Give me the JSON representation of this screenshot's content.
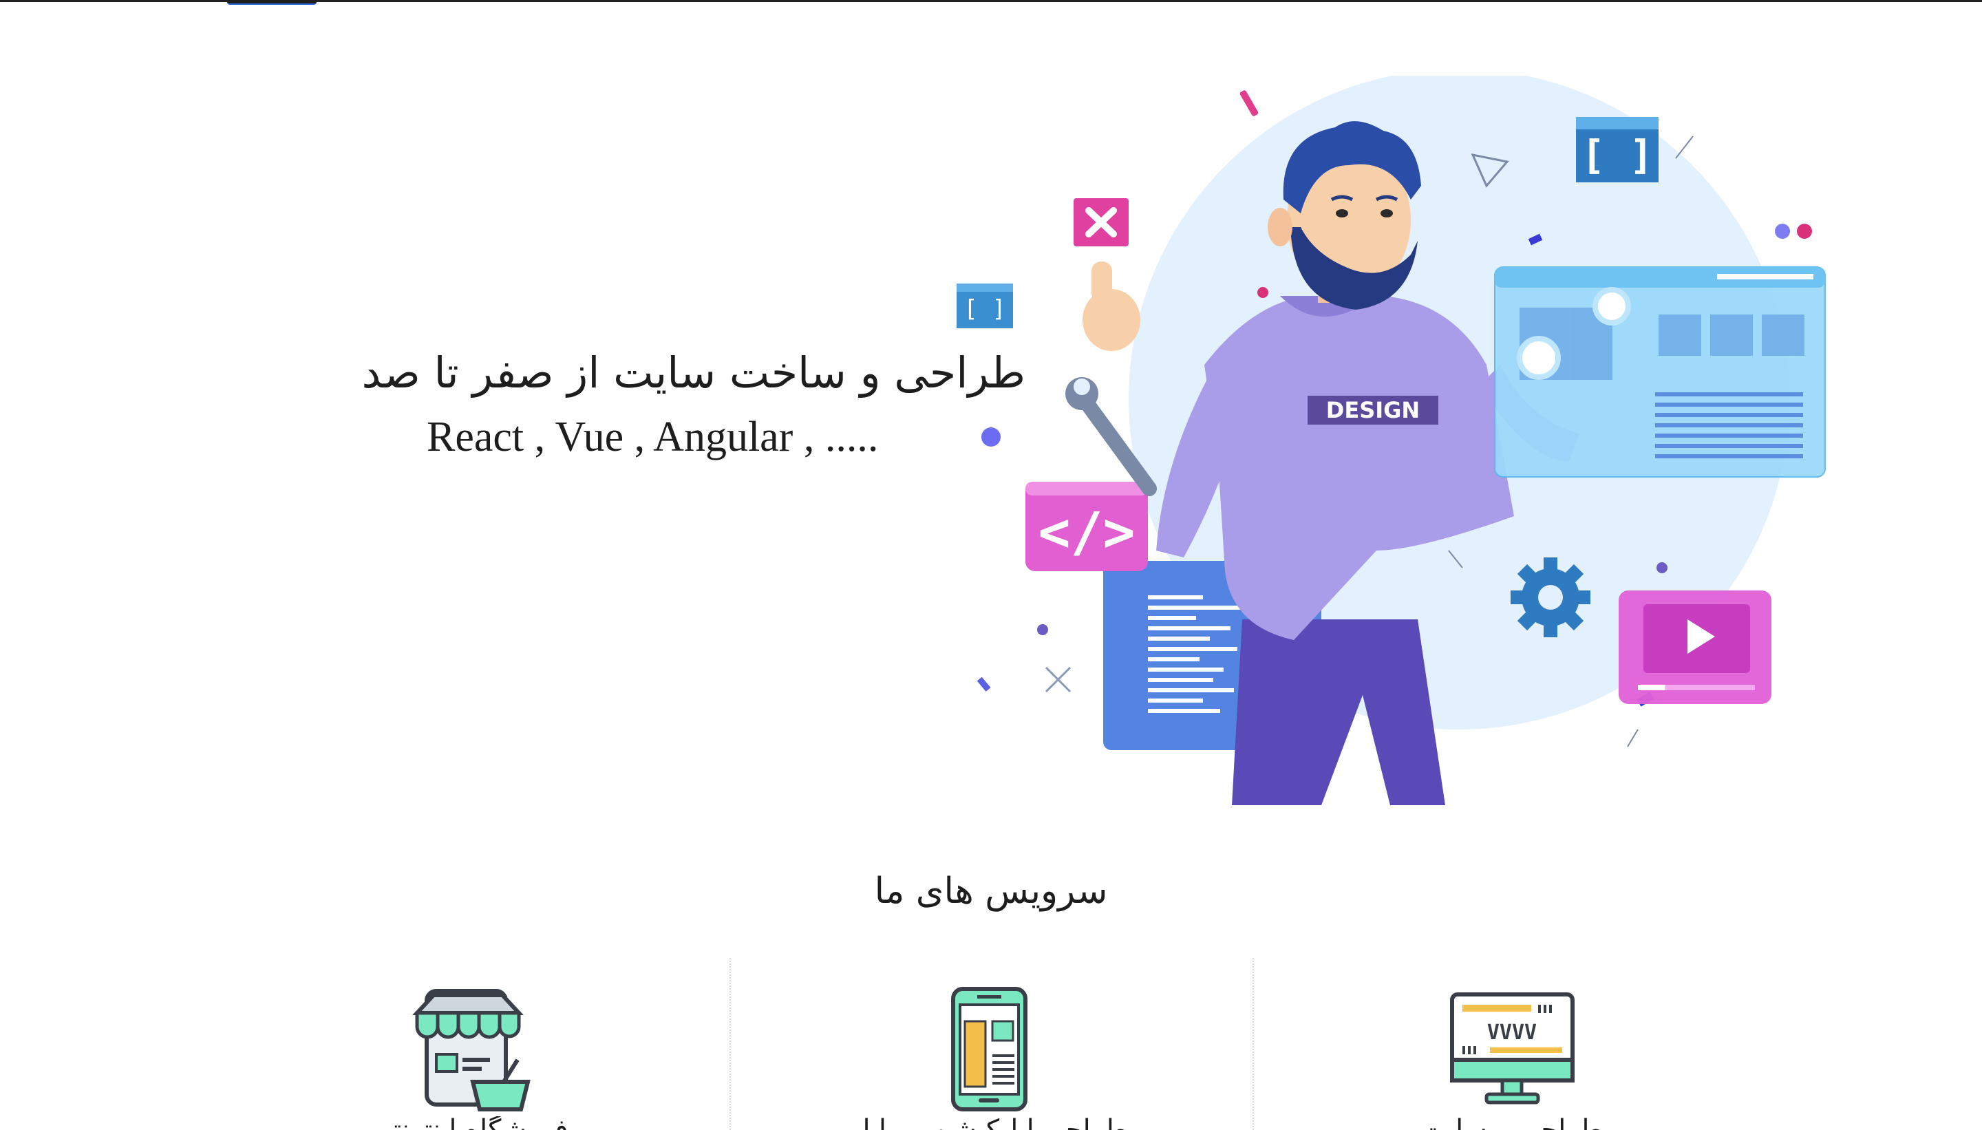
{
  "hero": {
    "title": "طراحی و ساخت سایت از صفر تا صد",
    "subtitle": "React , Vue , Angular , .....",
    "illustration_badge": "DESIGN"
  },
  "services": {
    "title": "سرویس های ما",
    "items": [
      {
        "caption": "فروشگاه اینترنتی",
        "icon": "storefront-basket-icon"
      },
      {
        "caption": "طراحی اپلیکیشن موبایل",
        "icon": "mobile-app-icon"
      },
      {
        "caption": "طراحی وبسایت",
        "icon": "monitor-www-icon"
      }
    ]
  },
  "colors": {
    "text": "#1d1d1d",
    "accent_purple": "#8b7fe0",
    "accent_pink": "#e15fd0",
    "accent_blue": "#3c8ee0",
    "bg_circle": "#e3f0fd",
    "icon_green": "#7ae8c0"
  }
}
